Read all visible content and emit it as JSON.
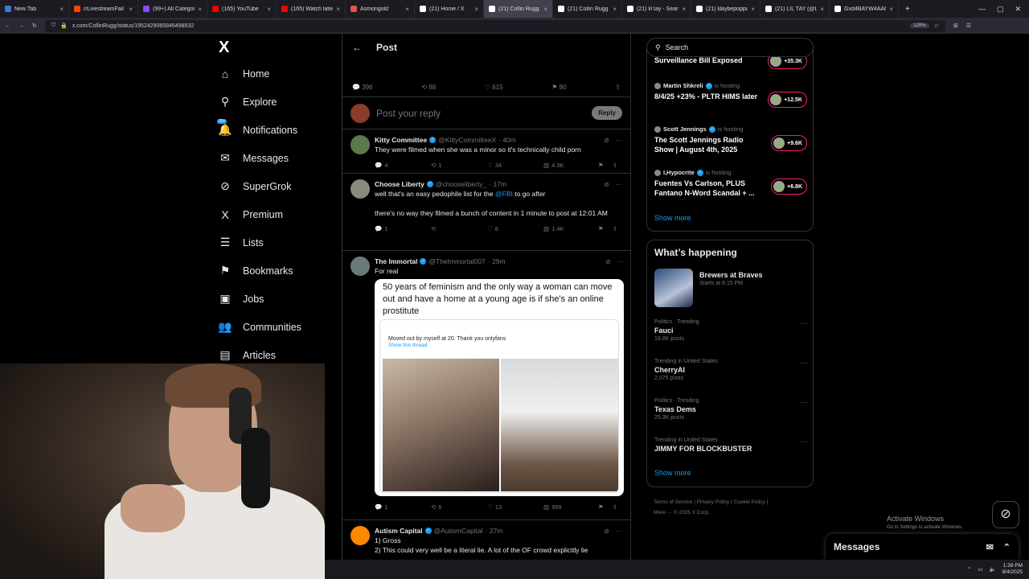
{
  "browser": {
    "tabs": [
      {
        "label": "New Tab",
        "color": "#3a7bd5"
      },
      {
        "label": "r/LivestreamFail",
        "color": "#ff4500"
      },
      {
        "label": "(99+) All Categories -",
        "color": "#9146ff"
      },
      {
        "label": "(165) YouTube",
        "color": "#ff0000"
      },
      {
        "label": "(165) Watch later - Yo",
        "color": "#ff0000"
      },
      {
        "label": "Asmongold",
        "color": "#e0554a"
      },
      {
        "label": "(21) Home / X",
        "color": "#ffffff"
      },
      {
        "label": "(21) Collin Rugg on X",
        "color": "#ffffff",
        "active": true
      },
      {
        "label": "(21) Collin Rugg on X",
        "color": "#ffffff"
      },
      {
        "label": "(21) lil tay - Search / X",
        "color": "#ffffff"
      },
      {
        "label": "(21) lilaybepoppin - S",
        "color": "#ffffff"
      },
      {
        "label": "(21) LIL TAY (@LilTayt",
        "color": "#ffffff"
      },
      {
        "label": "Gxd4BAYW4AA6IZX (J",
        "color": "#ffffff"
      }
    ],
    "url": "x.com/CollinRugg/status/1952429065846498932",
    "zoom": "120%"
  },
  "nav": {
    "logo": "X",
    "notification_badge": "20+",
    "items": [
      {
        "label": "Home",
        "icon": "⌂",
        "icon_name": "home-icon"
      },
      {
        "label": "Explore",
        "icon": "⚲",
        "icon_name": "search-icon"
      },
      {
        "label": "Notifications",
        "icon": "🔔",
        "icon_name": "bell-icon"
      },
      {
        "label": "Messages",
        "icon": "✉",
        "icon_name": "mail-icon"
      },
      {
        "label": "SuperGrok",
        "icon": "⊘",
        "icon_name": "grok-icon"
      },
      {
        "label": "Premium",
        "icon": "X",
        "icon_name": "x-premium-icon"
      },
      {
        "label": "Lists",
        "icon": "☰",
        "icon_name": "list-icon"
      },
      {
        "label": "Bookmarks",
        "icon": "⚑",
        "icon_name": "bookmark-icon"
      },
      {
        "label": "Jobs",
        "icon": "▣",
        "icon_name": "briefcase-icon"
      },
      {
        "label": "Communities",
        "icon": "👥",
        "icon_name": "people-icon"
      },
      {
        "label": "Articles",
        "icon": "▤",
        "icon_name": "article-icon"
      }
    ]
  },
  "post": {
    "header": "Post",
    "stats": {
      "replies": "396",
      "reposts": "88",
      "likes": "615",
      "bookmarks": "80"
    },
    "reply_placeholder": "Post your reply",
    "reply_button": "Reply"
  },
  "replies": [
    {
      "name": "Kitty Committee",
      "handle": "@KittyCommitteeX",
      "time": "· 40m",
      "avatar_color": "#5a7a4a",
      "text": "They were filmed when she was a minor so it's technically child porn",
      "replies": "4",
      "reposts": "1",
      "likes": "34",
      "views": "4.3K"
    },
    {
      "name": "Choose Liberty",
      "handle": "@chooseliberty_",
      "time": "· 17m",
      "avatar_color": "#8a8a7a",
      "text_pre": "well that's an easy pedophile list for the ",
      "mention": "@FBI",
      "text_post": " to go after",
      "text2": "there's no way they filmed a bunch of content in 1 minute to post at 12:01 AM",
      "replies": "1",
      "reposts": "",
      "likes": "8",
      "views": "1.4K"
    },
    {
      "name": "The Immortal",
      "handle": "@TheImmortal007",
      "time": "· 29m",
      "avatar_color": "#6a7a7a",
      "text": "For real",
      "media_caption": "50 years of feminism and the only way a woman can move out and have a home at a young age is if she's an online prostitute",
      "media_inner_text": "Moved out by myself at 20. Thank you onlyfans",
      "media_inner_link": "Show this thread",
      "replies": "1",
      "reposts": "6",
      "likes": "13",
      "views": "999"
    },
    {
      "name": "Autism Capital",
      "handle": "@AutismCapital",
      "time": "· 27m",
      "avatar_color": "#ff8800",
      "text": "1) Gross",
      "text2": "2) This could very well be a literal lie. A lot of the OF crowd explicitly lie"
    }
  ],
  "right": {
    "search_placeholder": "Search",
    "spaces": [
      {
        "host": "",
        "title": "Surveillance Bill Exposed",
        "count": "+35.3K"
      },
      {
        "host": "Martin Shkreli",
        "label": "is hosting",
        "title": "8/4/25 +23% - PLTR HIMS later",
        "count": "+12.5K"
      },
      {
        "host": "Scott Jennings",
        "label": "is hosting",
        "title": "The Scott Jennings Radio Show | August 4th, 2025",
        "count": "+9.6K"
      },
      {
        "host": "I,Hypocrite",
        "label": "is hosting",
        "title": "Fuentes Vs Carlson, PLUS Fantano N-Word Scandal + ...",
        "count": "+6.8K"
      }
    ],
    "spaces_show_more": "Show more",
    "happening_title": "What’s happening",
    "event": {
      "title": "Brewers at Braves",
      "subtitle": "Starts at 6:15 PM"
    },
    "trends": [
      {
        "context": "Politics · Trending",
        "title": "Fauci",
        "count": "18.8K posts"
      },
      {
        "context": "Trending in United States",
        "title": "CherryAI",
        "count": "2,075 posts"
      },
      {
        "context": "Politics · Trending",
        "title": "Texas Dems",
        "count": "25.3K posts"
      },
      {
        "context": "Trending in United States",
        "title": "JIMMY FOR BLOCKBUSTER",
        "count": ""
      }
    ],
    "happening_show_more": "Show more",
    "footer_links": [
      "Terms of Service",
      "Privacy Policy",
      "Cookie Policy"
    ],
    "footer_more": "More ···",
    "footer_copyright": "© 2025 X Corp."
  },
  "windows": {
    "activate": "Activate Windows",
    "activate_sub": "Go to Settings to activate Windows.",
    "time": "1:39 PM",
    "date": "8/4/2025"
  },
  "messages_drawer": "Messages"
}
